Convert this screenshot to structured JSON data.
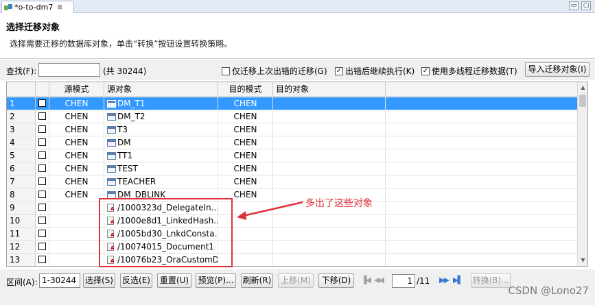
{
  "tab": {
    "title": "*o-to-dm7",
    "close": "⊠"
  },
  "window_buttons": [
    "▢",
    "▭"
  ],
  "header": {
    "title": "选择迁移对象",
    "description": "选择需要迁移的数据库对象，单击“转换”按钮设置转换策略。"
  },
  "toolbar": {
    "find_label": "查找(F):",
    "find_value": "",
    "count": "(共 30244)",
    "opt_only_failed": {
      "label": "仅迁移上次出错的迁移(G)",
      "checked": false
    },
    "opt_continue": {
      "label": "出错后继续执行(K)",
      "checked": true
    },
    "opt_multithread": {
      "label": "使用多线程迁移数据(T)",
      "checked": true
    },
    "import_button": "导入迁移对象(I)"
  },
  "table": {
    "columns": [
      "源模式",
      "源对象",
      "目的模式",
      "目的对象"
    ],
    "rows": [
      {
        "num": "1",
        "schema": "CHEN",
        "object": "DM_T1",
        "icon": "table-icon",
        "dest_schema": "CHEN",
        "dest_object": "",
        "selected": true
      },
      {
        "num": "2",
        "schema": "CHEN",
        "object": "DM_T2",
        "icon": "table-icon",
        "dest_schema": "CHEN",
        "dest_object": "",
        "selected": false
      },
      {
        "num": "3",
        "schema": "CHEN",
        "object": "T3",
        "icon": "table-icon",
        "dest_schema": "CHEN",
        "dest_object": "",
        "selected": false
      },
      {
        "num": "4",
        "schema": "CHEN",
        "object": "DM",
        "icon": "table-icon",
        "dest_schema": "CHEN",
        "dest_object": "",
        "selected": false
      },
      {
        "num": "5",
        "schema": "CHEN",
        "object": "TT1",
        "icon": "table-icon",
        "dest_schema": "CHEN",
        "dest_object": "",
        "selected": false
      },
      {
        "num": "6",
        "schema": "CHEN",
        "object": "TEST",
        "icon": "table-icon",
        "dest_schema": "CHEN",
        "dest_object": "",
        "selected": false
      },
      {
        "num": "7",
        "schema": "CHEN",
        "object": "TEACHER",
        "icon": "table-icon",
        "dest_schema": "CHEN",
        "dest_object": "",
        "selected": false
      },
      {
        "num": "8",
        "schema": "CHEN",
        "object": "DM_DBLINK",
        "icon": "table-icon",
        "dest_schema": "CHEN",
        "dest_object": "",
        "selected": false
      },
      {
        "num": "9",
        "schema": "",
        "object": "/1000323d_DelegateIn...",
        "icon": "java-class-icon",
        "dest_schema": "",
        "dest_object": "",
        "selected": false
      },
      {
        "num": "10",
        "schema": "",
        "object": "/1000e8d1_LinkedHash..",
        "icon": "java-class-icon",
        "dest_schema": "",
        "dest_object": "",
        "selected": false
      },
      {
        "num": "11",
        "schema": "",
        "object": "/1005bd30_LnkdConsta..",
        "icon": "java-class-icon",
        "dest_schema": "",
        "dest_object": "",
        "selected": false
      },
      {
        "num": "12",
        "schema": "",
        "object": "/10074015_Document1",
        "icon": "java-class-icon",
        "dest_schema": "",
        "dest_object": "",
        "selected": false
      },
      {
        "num": "13",
        "schema": "",
        "object": "/10076b23_OraCustomD",
        "icon": "java-class-icon",
        "dest_schema": "",
        "dest_object": "",
        "selected": false
      }
    ]
  },
  "annotation": {
    "text": "多出了这些对象",
    "color": "#e0303a"
  },
  "bottom": {
    "range_label": "区间(A):",
    "range_value": "1-30244",
    "select": "选择(S)",
    "invert": "反选(E)",
    "reset": "重置(U)",
    "preview": "预览(P)...",
    "refresh": "刷新(R)",
    "move_up": "上移(M)",
    "move_down": "下移(D)",
    "page_current": "1",
    "page_total": "/11",
    "convert": "转换(B)..."
  },
  "watermark": "CSDN @Lono27",
  "colors": {
    "selection": "#3399ff",
    "annotation": "#e0303a"
  }
}
